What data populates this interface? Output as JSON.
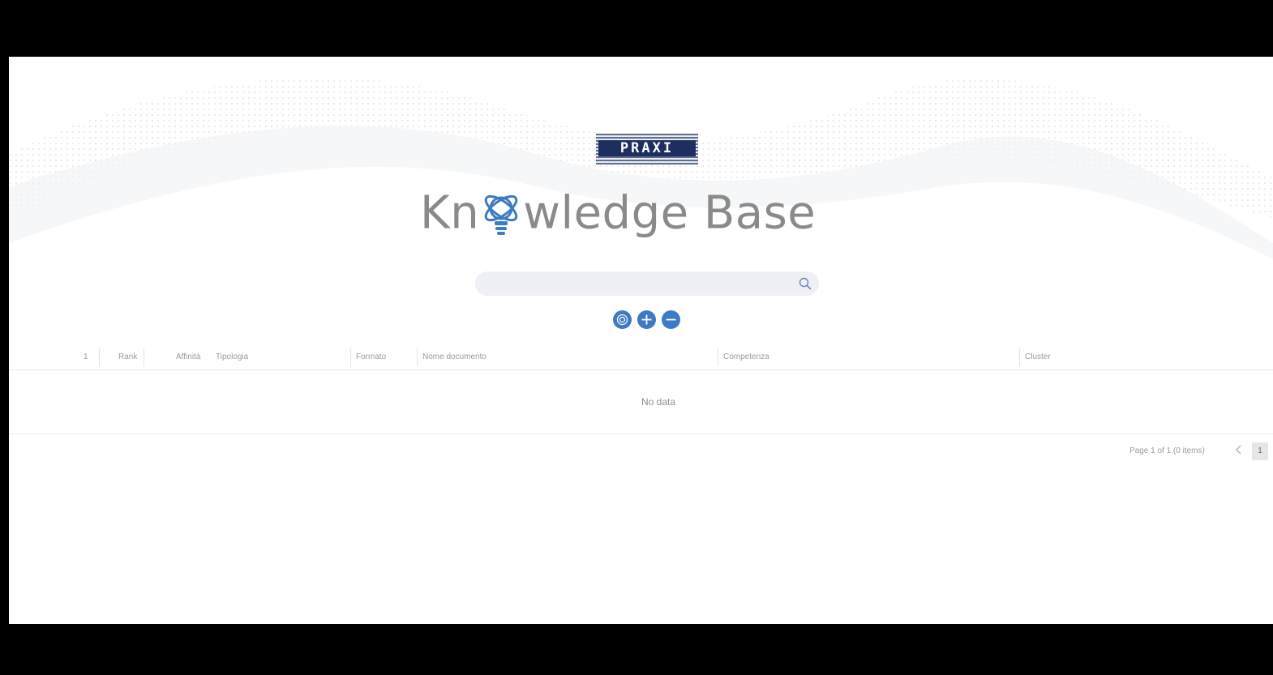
{
  "logo": {
    "text": "PRAXI"
  },
  "title": {
    "part1": "Kn",
    "part2": "wledge",
    "part3": "Base"
  },
  "search": {
    "placeholder": ""
  },
  "columns": [
    "1",
    "Rank",
    "Affinità",
    "Tipologia",
    "Formato",
    "Nome documento",
    "Competenza",
    "Cluster"
  ],
  "grid": {
    "empty_text": "No data"
  },
  "pager": {
    "info": "Page 1 of 1 (0 items)",
    "current_page": "1"
  },
  "colors": {
    "accent": "#3d7ac4",
    "logo_bg": "#1d2f5e",
    "title": "#8a8a8a"
  }
}
